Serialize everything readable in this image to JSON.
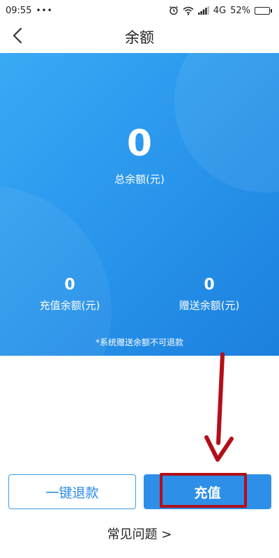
{
  "status_bar": {
    "time": "09:55",
    "dots": "•••",
    "network": "4G",
    "battery_percent": "52%",
    "battery_level": 0.52,
    "icons": [
      "alarm-icon",
      "wifi-icon",
      "signal-icon",
      "battery-icon"
    ]
  },
  "nav": {
    "title": "余额",
    "back_icon": "chevron-left-icon"
  },
  "balance": {
    "total_value": "0",
    "total_label": "总余额(元)",
    "recharge_value": "0",
    "recharge_label": "充值余额(元)",
    "gift_value": "0",
    "gift_label": "赠送余额(元)",
    "note": "*系统赠送余额不可退款"
  },
  "actions": {
    "refund_label": "一键退款",
    "recharge_label": "充值"
  },
  "faq": {
    "label": "常见问题 >"
  },
  "colors": {
    "card_gradient_start": "#39aaf5",
    "card_gradient_end": "#1b80dd",
    "primary": "#2d8fe7",
    "annotation_red": "#b30f18"
  }
}
